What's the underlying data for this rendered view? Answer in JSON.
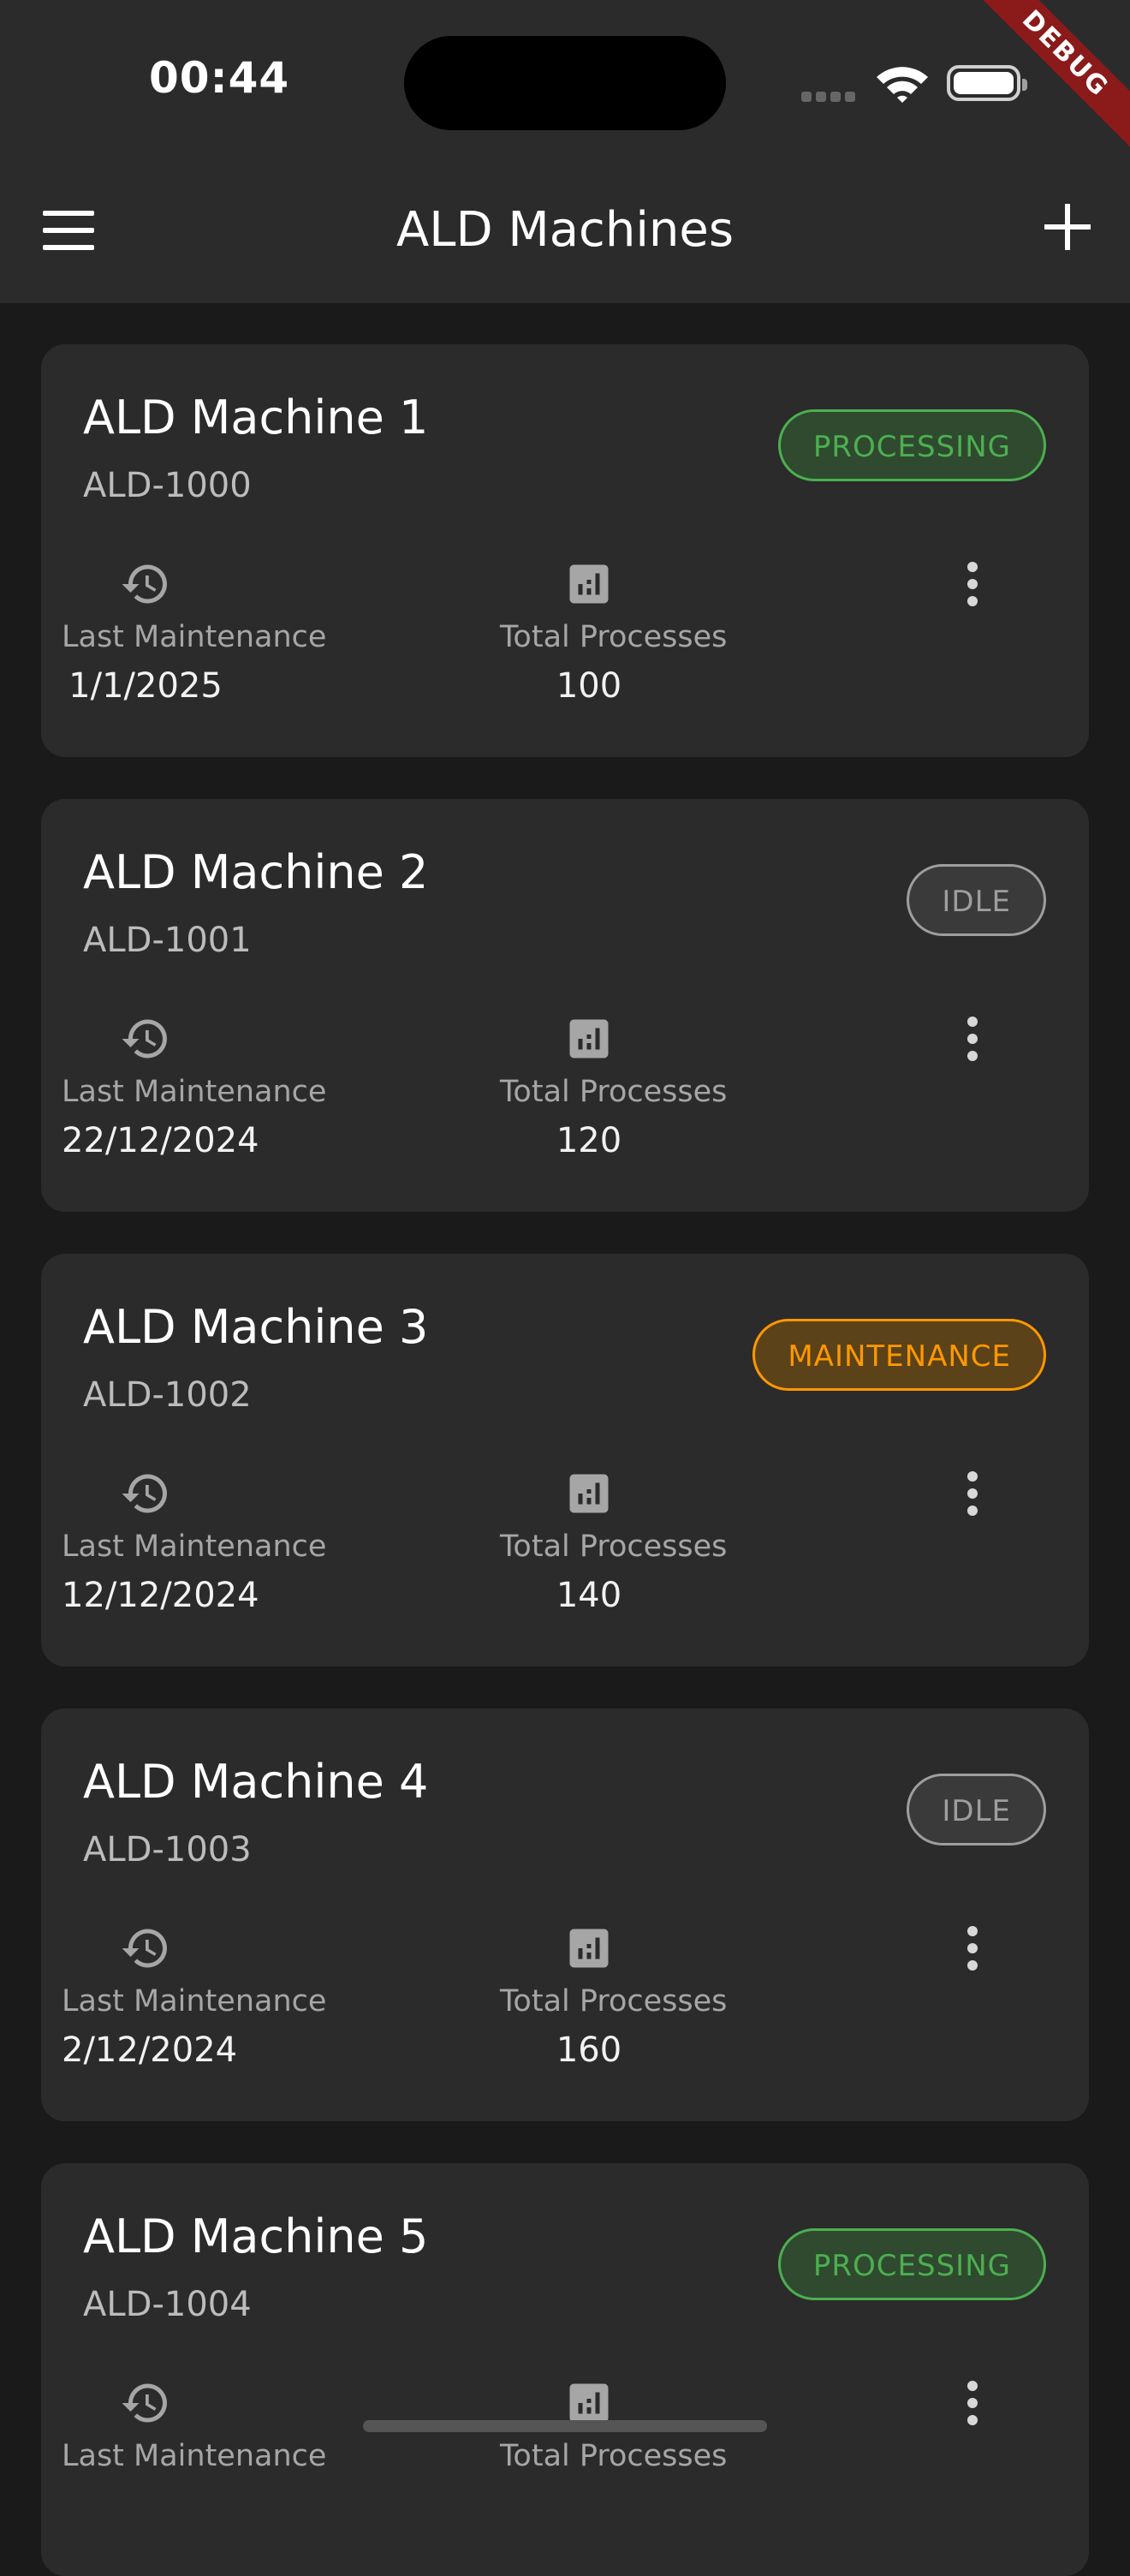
{
  "status_bar": {
    "time": "00:44",
    "debug_label": "DEBUG"
  },
  "app_bar": {
    "title": "ALD Machines",
    "menu_icon": "menu-icon",
    "add_icon": "add-icon"
  },
  "labels": {
    "last_maintenance": "Last Maintenance",
    "total_processes": "Total Processes"
  },
  "colors": {
    "background": "#1a1a1a",
    "surface": "#2b2b2b",
    "processing": "#4caf50",
    "idle": "#9e9e9e",
    "maintenance": "#ff9800"
  },
  "machines": [
    {
      "name": "ALD Machine 1",
      "id": "ALD-1000",
      "status": "PROCESSING",
      "last_maintenance": "1/1/2025",
      "total_processes": "100"
    },
    {
      "name": "ALD Machine 2",
      "id": "ALD-1001",
      "status": "IDLE",
      "last_maintenance": "22/12/2024",
      "total_processes": "120"
    },
    {
      "name": "ALD Machine 3",
      "id": "ALD-1002",
      "status": "MAINTENANCE",
      "last_maintenance": "12/12/2024",
      "total_processes": "140"
    },
    {
      "name": "ALD Machine 4",
      "id": "ALD-1003",
      "status": "IDLE",
      "last_maintenance": "2/12/2024",
      "total_processes": "160"
    },
    {
      "name": "ALD Machine 5",
      "id": "ALD-1004",
      "status": "PROCESSING",
      "last_maintenance": "",
      "total_processes": ""
    }
  ]
}
